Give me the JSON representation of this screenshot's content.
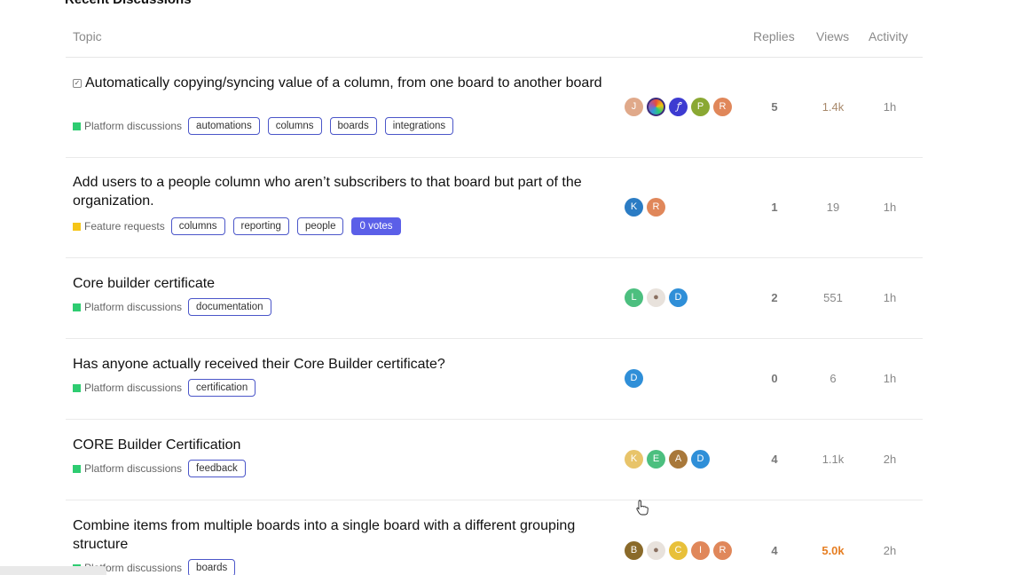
{
  "section_title": "Recent Discussions",
  "columns": {
    "topic": "Topic",
    "replies": "Replies",
    "views": "Views",
    "activity": "Activity"
  },
  "colors": {
    "platform": "#2ecc71",
    "feature": "#f5c518",
    "tag_border": "#4b56c9",
    "votes_bg": "#5b5fe8",
    "views_hot": "#e67e22"
  },
  "rows": [
    {
      "title": "Automatically copying/syncing value of a column, from one board to another board",
      "solved_icon": "checkbox-icon",
      "category": "Platform discussions",
      "tags": [
        "automations",
        "columns",
        "boards",
        "integrations"
      ],
      "avatars": [
        "J",
        "",
        "",
        "P",
        "R"
      ],
      "replies": "5",
      "views": "1.4k",
      "activity": "1h"
    },
    {
      "title": "Add users to a people column who aren’t subscribers to that board but part of the organization.",
      "category": "Feature requests",
      "tags": [
        "columns",
        "reporting",
        "people"
      ],
      "votes": "0 votes",
      "avatars": [
        "K",
        "R"
      ],
      "replies": "1",
      "views": "19",
      "activity": "1h"
    },
    {
      "title": "Core builder certificate",
      "category": "Platform discussions",
      "tags": [
        "documentation"
      ],
      "avatars": [
        "L",
        "",
        "D"
      ],
      "replies": "2",
      "views": "551",
      "activity": "1h"
    },
    {
      "title": "Has anyone actually received their Core Builder certificate?",
      "category": "Platform discussions",
      "tags": [
        "certification"
      ],
      "avatars": [
        "D"
      ],
      "replies": "0",
      "views": "6",
      "activity": "1h"
    },
    {
      "title": "CORE Builder Certification",
      "category": "Platform discussions",
      "tags": [
        "feedback"
      ],
      "avatars": [
        "K",
        "E",
        "A",
        "D"
      ],
      "replies": "4",
      "views": "1.1k",
      "activity": "2h"
    },
    {
      "title": "Combine items from multiple boards into a single board with a different grouping structure",
      "category": "Platform discussions",
      "tags": [
        "boards"
      ],
      "avatars": [
        "B",
        "",
        "C",
        "I",
        "R"
      ],
      "replies": "4",
      "views": "5.0k",
      "activity": "2h"
    }
  ]
}
